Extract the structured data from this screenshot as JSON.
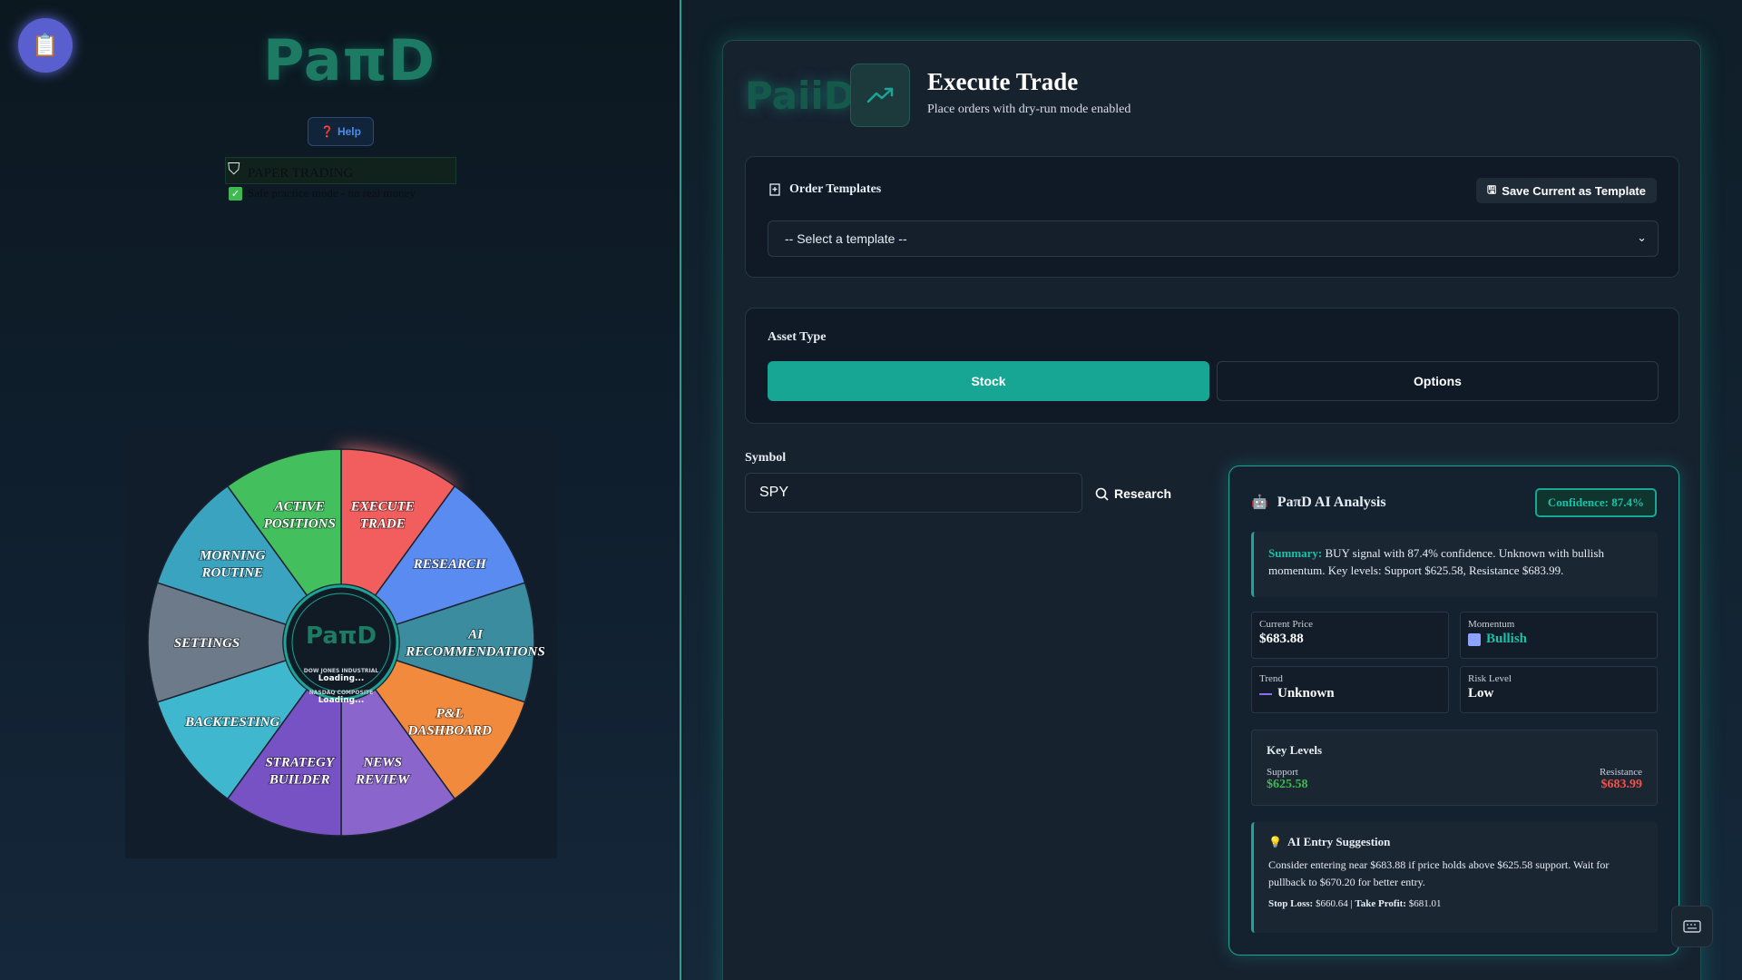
{
  "left": {
    "brand": "PaπD",
    "help_label": "Help",
    "paper_title": "PAPER TRADING",
    "paper_sub": "Safe practice mode - no real money",
    "wheel": {
      "center_logo": "PaπD",
      "center_line1": "DOW JONES INDUSTRIAL",
      "center_loading1": "Loading...",
      "center_line2": "NASDAQ COMPOSITE",
      "center_loading2": "Loading...",
      "segments": [
        {
          "label": "EXECUTE TRADE",
          "color": "#f25e5e"
        },
        {
          "label": "RESEARCH",
          "color": "#5a8bf0"
        },
        {
          "label": "AI RECOMMENDATIONS",
          "color": "#3a8c9e"
        },
        {
          "label": "P&L DASHBOARD",
          "color": "#f28a3e"
        },
        {
          "label": "NEWS REVIEW",
          "color": "#8a66cc"
        },
        {
          "label": "STRATEGY BUILDER",
          "color": "#7752c4"
        },
        {
          "label": "BACKTESTING",
          "color": "#3fb8cf"
        },
        {
          "label": "SETTINGS",
          "color": "#6c7a8a"
        },
        {
          "label": "MORNING ROUTINE",
          "color": "#3aa3bf"
        },
        {
          "label": "ACTIVE POSITIONS",
          "color": "#43c05d"
        }
      ]
    }
  },
  "trade": {
    "logo": "PaiiD",
    "title": "Execute Trade",
    "subtitle": "Place orders with dry-run mode enabled",
    "templates_heading": "Order Templates",
    "save_template_label": "Save Current as Template",
    "template_select_value": "-- Select a template --",
    "asset_heading": "Asset Type",
    "stock_label": "Stock",
    "options_label": "Options",
    "symbol_label": "Symbol",
    "symbol_value": "SPY",
    "research_label": "Research"
  },
  "ai": {
    "title": "PaπD AI Analysis",
    "confidence": "Confidence: 87.4%",
    "summary_label": "Summary:",
    "summary_text": "BUY signal with 87.4% confidence. Unknown with bullish momentum. Key levels: Support $625.58, Resistance $683.99.",
    "current_price_label": "Current Price",
    "current_price": "$683.88",
    "momentum_label": "Momentum",
    "momentum": "Bullish",
    "trend_label": "Trend",
    "trend": "Unknown",
    "risk_label": "Risk Level",
    "risk": "Low",
    "key_levels_title": "Key Levels",
    "support_label": "Support",
    "support": "$625.58",
    "resistance_label": "Resistance",
    "resistance": "$683.99",
    "entry_title": "AI Entry Suggestion",
    "entry_text": "Consider entering near $683.88 if price holds above $625.58 support. Wait for pullback to $670.20 for better entry.",
    "stop_loss_label": "Stop Loss:",
    "stop_loss": "$660.64",
    "take_profit_label": "Take Profit:",
    "take_profit": "$681.01"
  },
  "colors": {
    "accent": "#1aa596",
    "support": "#3fb950",
    "resistance": "#f85149"
  }
}
